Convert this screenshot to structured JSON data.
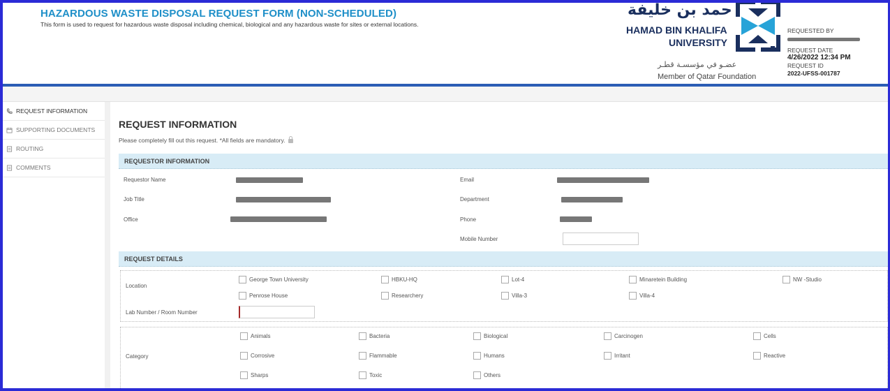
{
  "header": {
    "title": "HAZARDOUS WASTE DISPOSAL REQUEST FORM (NON-SCHEDULED)",
    "subtitle": "This form is used to request for hazardous waste disposal including chemical, biological and any hazardous waste for sites or external locations.",
    "logo": {
      "arabic": "حمد بن خليفة",
      "english_line1": "HAMAD BIN KHALIFA",
      "english_line2": "UNIVERSITY",
      "qf_arabic": "عضـو في مؤسسـة قطـر",
      "qf_english": "Member of Qatar Foundation",
      "icon": "hbku-logo-icon"
    },
    "meta": {
      "requested_by_label": "REQUESTED BY",
      "request_date_label": "REQUEST DATE",
      "request_date_value": "4/26/2022 12:34 PM",
      "request_id_label": "REQUEST ID",
      "request_id_value": "2022-UFSS-001787"
    }
  },
  "sidebar": {
    "items": [
      {
        "label": "REQUEST INFORMATION",
        "icon": "phone-icon",
        "active": true
      },
      {
        "label": "SUPPORTING DOCUMENTS",
        "icon": "calendar-icon",
        "active": false
      },
      {
        "label": "ROUTING",
        "icon": "document-icon",
        "active": false
      },
      {
        "label": "COMMENTS",
        "icon": "document-icon",
        "active": false
      }
    ]
  },
  "main": {
    "title": "REQUEST INFORMATION",
    "note": "Please completely fill out this request. *All fields are mandatory."
  },
  "requestor": {
    "section_title": "REQUESTOR INFORMATION",
    "requestor_name_label": "Requestor Name",
    "job_title_label": "Job Title",
    "office_label": "Office",
    "email_label": "Email",
    "department_label": "Department",
    "phone_label": "Phone",
    "mobile_label": "Mobile Number"
  },
  "details": {
    "section_title": "REQUEST DETAILS",
    "location_label": "Location",
    "locations": [
      "George Town University",
      "HBKU-HQ",
      "Lot-4",
      "Minaretein Building",
      "NW -Studio",
      "Penrose House",
      "Researchery",
      "Villa-3",
      "Villa-4"
    ],
    "lab_label": "Lab Number / Room Number",
    "category_label": "Category",
    "categories": [
      "Animals",
      "Bacteria",
      "Biological",
      "Carcinogen",
      "Cells",
      "Corrosive",
      "Flammable",
      "Humans",
      "Irritant",
      "Reactive",
      "Sharps",
      "Toxic",
      "Others"
    ]
  },
  "colors": {
    "frame": "#2b2bd6",
    "title": "#1e8fc8",
    "section_bar": "#d8ecf6",
    "logo": "#1a2f5e",
    "required_marker": "#a52a2a"
  }
}
